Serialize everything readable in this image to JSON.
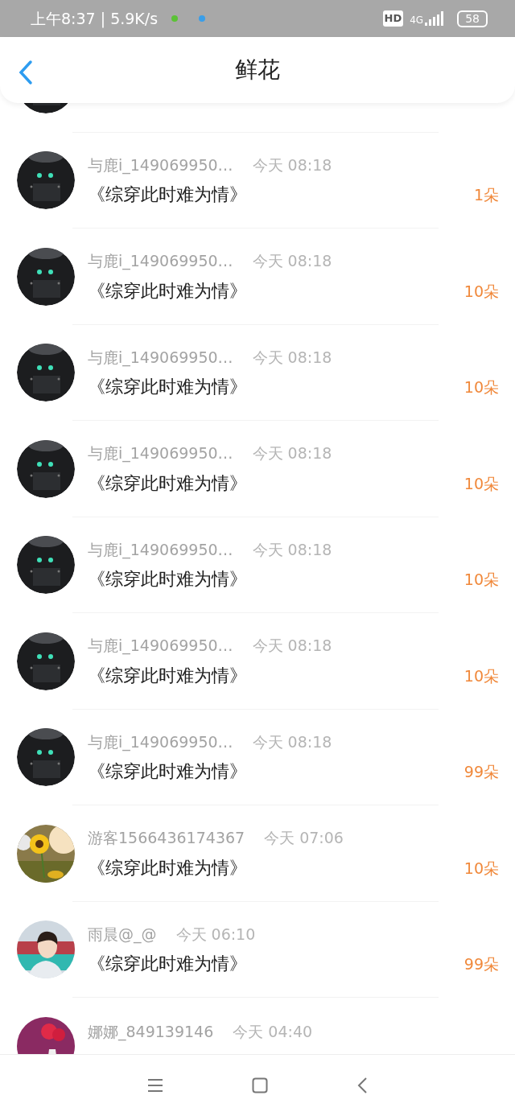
{
  "status_bar": {
    "time": "上午8:37 | 5.9K/s",
    "hd": "HD",
    "network": "4G",
    "battery": "58"
  },
  "header": {
    "title": "鲜花"
  },
  "rows": [
    {
      "name": "与鹿i_149069950…",
      "time": "今天 08:18",
      "title": "《综穿此时难为情》",
      "count": "1朵"
    },
    {
      "name": "与鹿i_149069950…",
      "time": "今天 08:18",
      "title": "《综穿此时难为情》",
      "count": "10朵"
    },
    {
      "name": "与鹿i_149069950…",
      "time": "今天 08:18",
      "title": "《综穿此时难为情》",
      "count": "10朵"
    },
    {
      "name": "与鹿i_149069950…",
      "time": "今天 08:18",
      "title": "《综穿此时难为情》",
      "count": "10朵"
    },
    {
      "name": "与鹿i_149069950…",
      "time": "今天 08:18",
      "title": "《综穿此时难为情》",
      "count": "10朵"
    },
    {
      "name": "与鹿i_149069950…",
      "time": "今天 08:18",
      "title": "《综穿此时难为情》",
      "count": "10朵"
    },
    {
      "name": "与鹿i_149069950…",
      "time": "今天 08:18",
      "title": "《综穿此时难为情》",
      "count": "99朵"
    },
    {
      "name": "游客1566436174367",
      "time": "今天 07:06",
      "title": "《综穿此时难为情》",
      "count": "10朵"
    },
    {
      "name": "雨晨@_@",
      "time": "今天 06:10",
      "title": "《综穿此时难为情》",
      "count": "99朵"
    },
    {
      "name": "娜娜_849139146",
      "time": "今天 04:40"
    }
  ]
}
